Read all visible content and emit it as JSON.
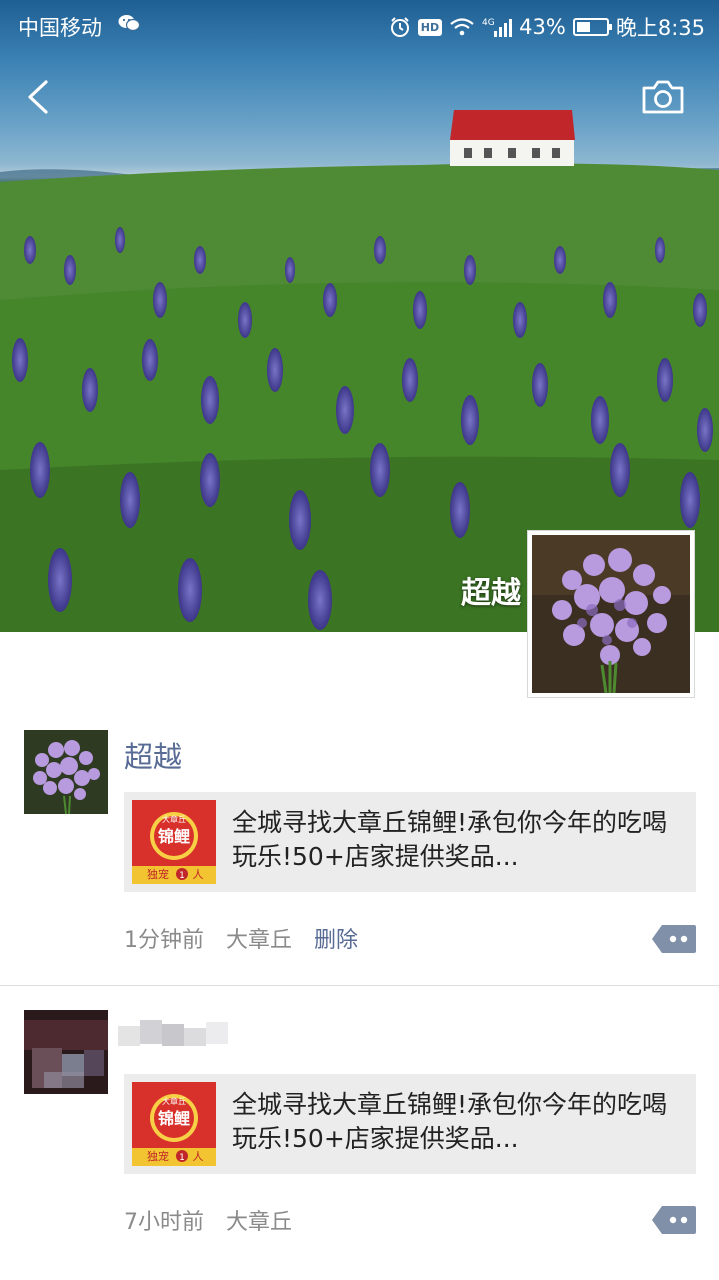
{
  "status_bar": {
    "carrier": "中国移动",
    "hd": "HD",
    "network": "4G",
    "battery": "43%",
    "battery_level": 0.43,
    "time": "晚上8:35"
  },
  "profile": {
    "name": "超越"
  },
  "posts": [
    {
      "author": "超越",
      "link_title": "全城寻找大章丘锦鲤!承包你今年的吃喝玩乐!50+店家提供奖品...",
      "thumb_text": {
        "top": "大章丘",
        "main": "锦鲤",
        "bottom": "独宠",
        "badge": "1",
        "suffix": "人"
      },
      "time": "1分钟前",
      "location": "大章丘",
      "delete_label": "删除"
    },
    {
      "author": "",
      "link_title": "全城寻找大章丘锦鲤!承包你今年的吃喝玩乐!50+店家提供奖品...",
      "thumb_text": {
        "top": "大章丘",
        "main": "锦鲤",
        "bottom": "独宠",
        "badge": "1",
        "suffix": "人"
      },
      "time": "7小时前",
      "location": "大章丘"
    }
  ],
  "colors": {
    "link_blue": "#576b95",
    "meta_gray": "#8a8a8a",
    "card_bg": "#ececec",
    "comment_btn": "#8090a8"
  },
  "icons": [
    "back-arrow-icon",
    "camera-icon",
    "wechat-icon",
    "alarm-icon",
    "wifi-icon",
    "signal-icon",
    "battery-icon",
    "comment-icon"
  ]
}
